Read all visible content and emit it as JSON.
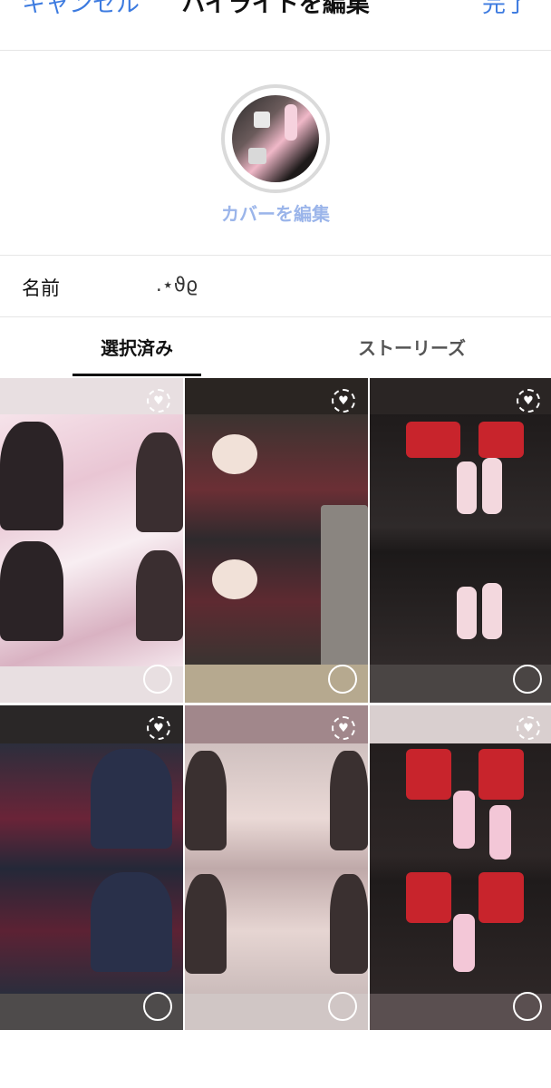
{
  "header": {
    "cancel_label": "キャンセル",
    "title": "ハイライトを編集",
    "done_label": "完了"
  },
  "cover": {
    "edit_label": "カバーを編集"
  },
  "name_row": {
    "label": "名前",
    "value": ".⋆ϑϱ"
  },
  "tabs": [
    {
      "label": "選択済み",
      "active": true
    },
    {
      "label": "ストーリーズ",
      "active": false
    }
  ],
  "grid": {
    "items": [
      {
        "heart_icon": "heart-badge-icon",
        "selected": false
      },
      {
        "heart_icon": "heart-badge-icon",
        "selected": false
      },
      {
        "heart_icon": "heart-badge-icon",
        "selected": false
      },
      {
        "heart_icon": "heart-badge-icon",
        "selected": false
      },
      {
        "heart_icon": "heart-badge-icon",
        "selected": false
      },
      {
        "heart_icon": "heart-badge-icon",
        "selected": false
      }
    ]
  },
  "colors": {
    "accent": "#3d7be0",
    "cover_edit": "#9bb5ea"
  }
}
